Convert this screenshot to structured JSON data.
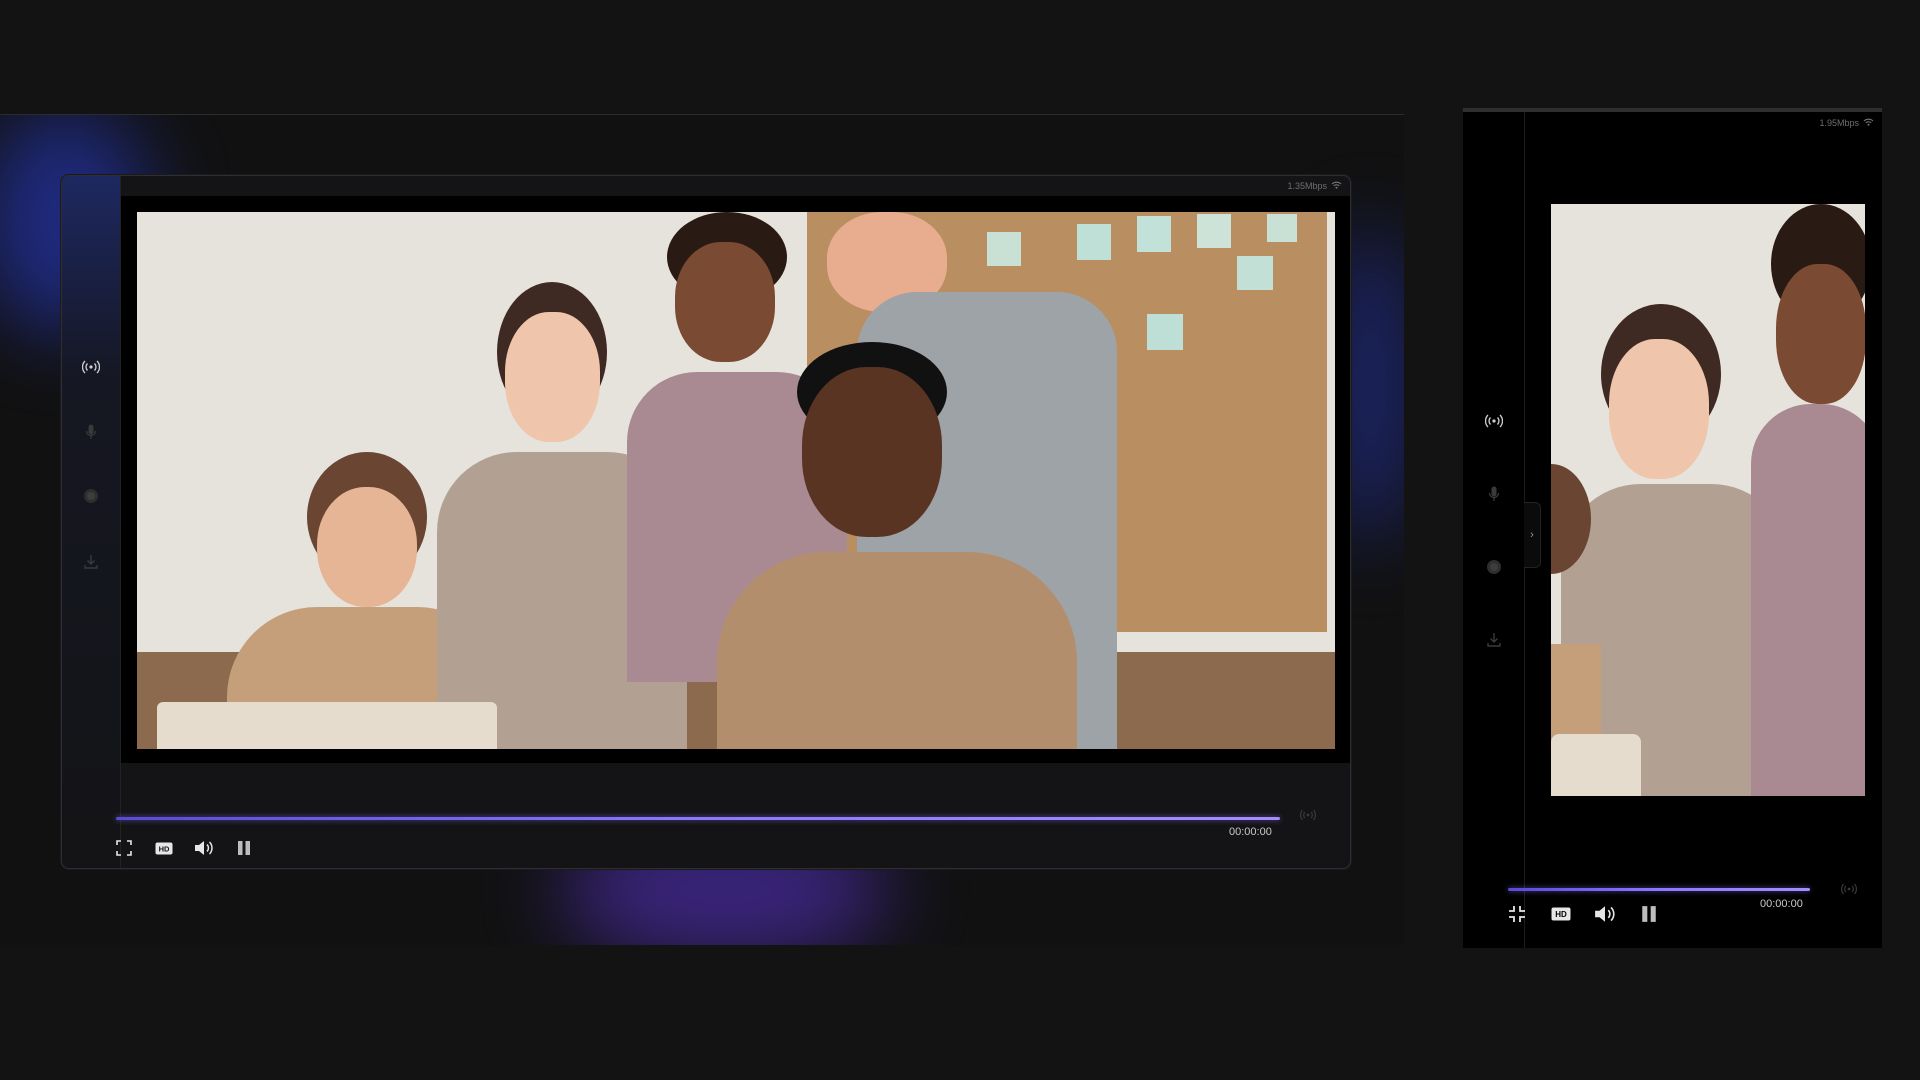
{
  "left_player": {
    "bitrate": "1.35Mbps",
    "time": "00:00:00",
    "progress": 1.0,
    "sidebar_icons": [
      "broadcast-icon",
      "microphone-icon",
      "record-icon",
      "download-icon"
    ],
    "controls": [
      "fullscreen-icon",
      "hd-icon",
      "volume-icon",
      "pause-icon"
    ]
  },
  "right_player": {
    "bitrate": "1.95Mbps",
    "time": "00:00:00",
    "progress": 1.0,
    "sidebar_icons": [
      "broadcast-icon",
      "microphone-icon",
      "record-icon",
      "download-icon"
    ],
    "controls": [
      "exit-fullscreen-icon",
      "hd-icon",
      "volume-icon",
      "pause-icon"
    ],
    "collapse_label": "›"
  },
  "colors": {
    "accent": "#8a78ff",
    "background": "#131313",
    "glow_blue": "#2a3fd8",
    "glow_violet": "#6a3ad8"
  }
}
